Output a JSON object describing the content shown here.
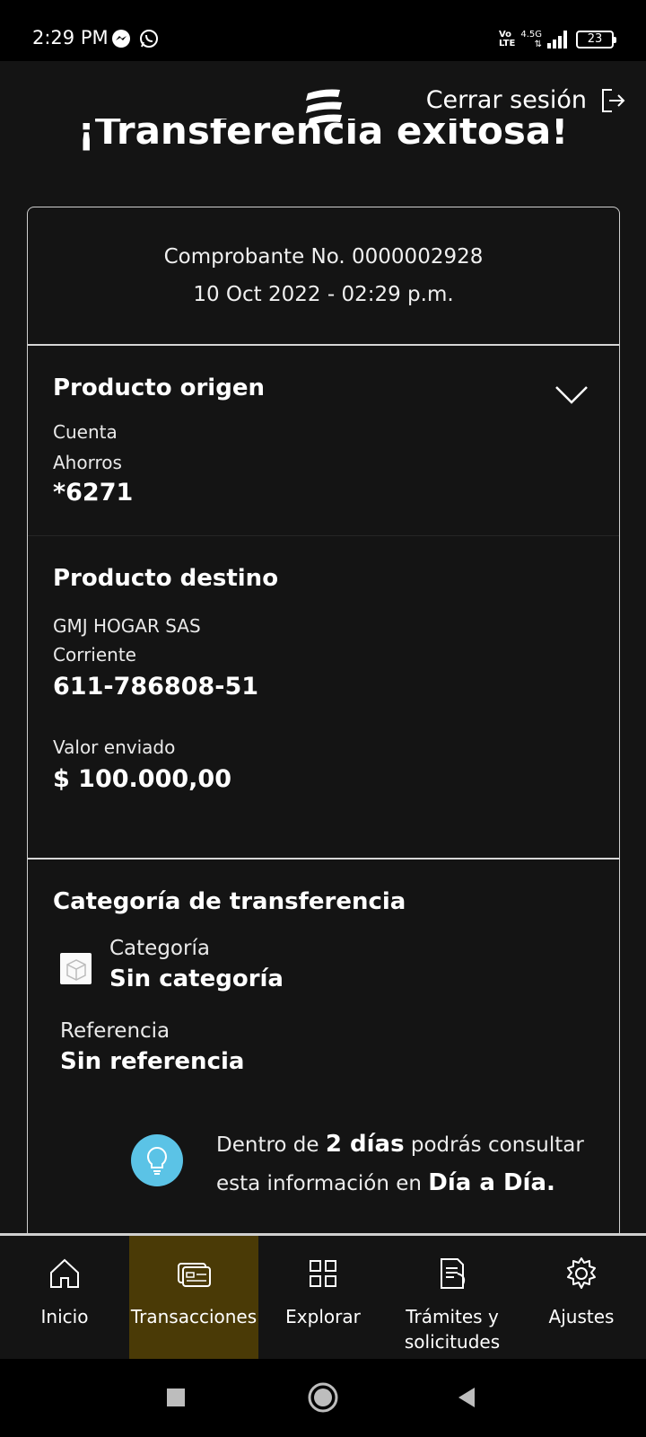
{
  "status_bar": {
    "time": "2:29 PM",
    "network_top": "Vo",
    "network_bottom": "LTE",
    "signal_type": "4.5G",
    "battery": "23"
  },
  "header": {
    "logout_label": "Cerrar sesión"
  },
  "page": {
    "title": "¡Transferencia exitosa!"
  },
  "receipt": {
    "number": "Comprobante No. 0000002928",
    "date": "10 Oct 2022 - 02:29 p.m."
  },
  "origin": {
    "title": "Producto origen",
    "type": "Cuenta",
    "subtype": "Ahorros",
    "account": "*6271"
  },
  "destination": {
    "title": "Producto destino",
    "name": "GMJ HOGAR SAS",
    "type": "Corriente",
    "account": "611-786808-51",
    "amount_label": "Valor enviado",
    "amount": "$ 100.000,00"
  },
  "category": {
    "title": "Categoría de transferencia",
    "label": "Categoría",
    "value": "Sin categoría",
    "reference_label": "Referencia",
    "reference_value": "Sin referencia"
  },
  "info": {
    "text_1": "Dentro de ",
    "highlight_1": "2 días",
    "text_2": " podrás consultar esta información en ",
    "highlight_2": "Día a Día."
  },
  "bottom_nav": {
    "items": [
      {
        "label": "Inicio",
        "icon": "home-icon"
      },
      {
        "label": "Transacciones",
        "icon": "transactions-icon",
        "active": true
      },
      {
        "label": "Explorar",
        "icon": "grid-icon"
      },
      {
        "label": "Trámites y solicitudes",
        "icon": "document-icon"
      },
      {
        "label": "Ajustes",
        "icon": "gear-icon"
      }
    ]
  },
  "colors": {
    "background": "#141414",
    "active_nav": "#4a3a06",
    "info_accent": "#5bc3e6"
  }
}
